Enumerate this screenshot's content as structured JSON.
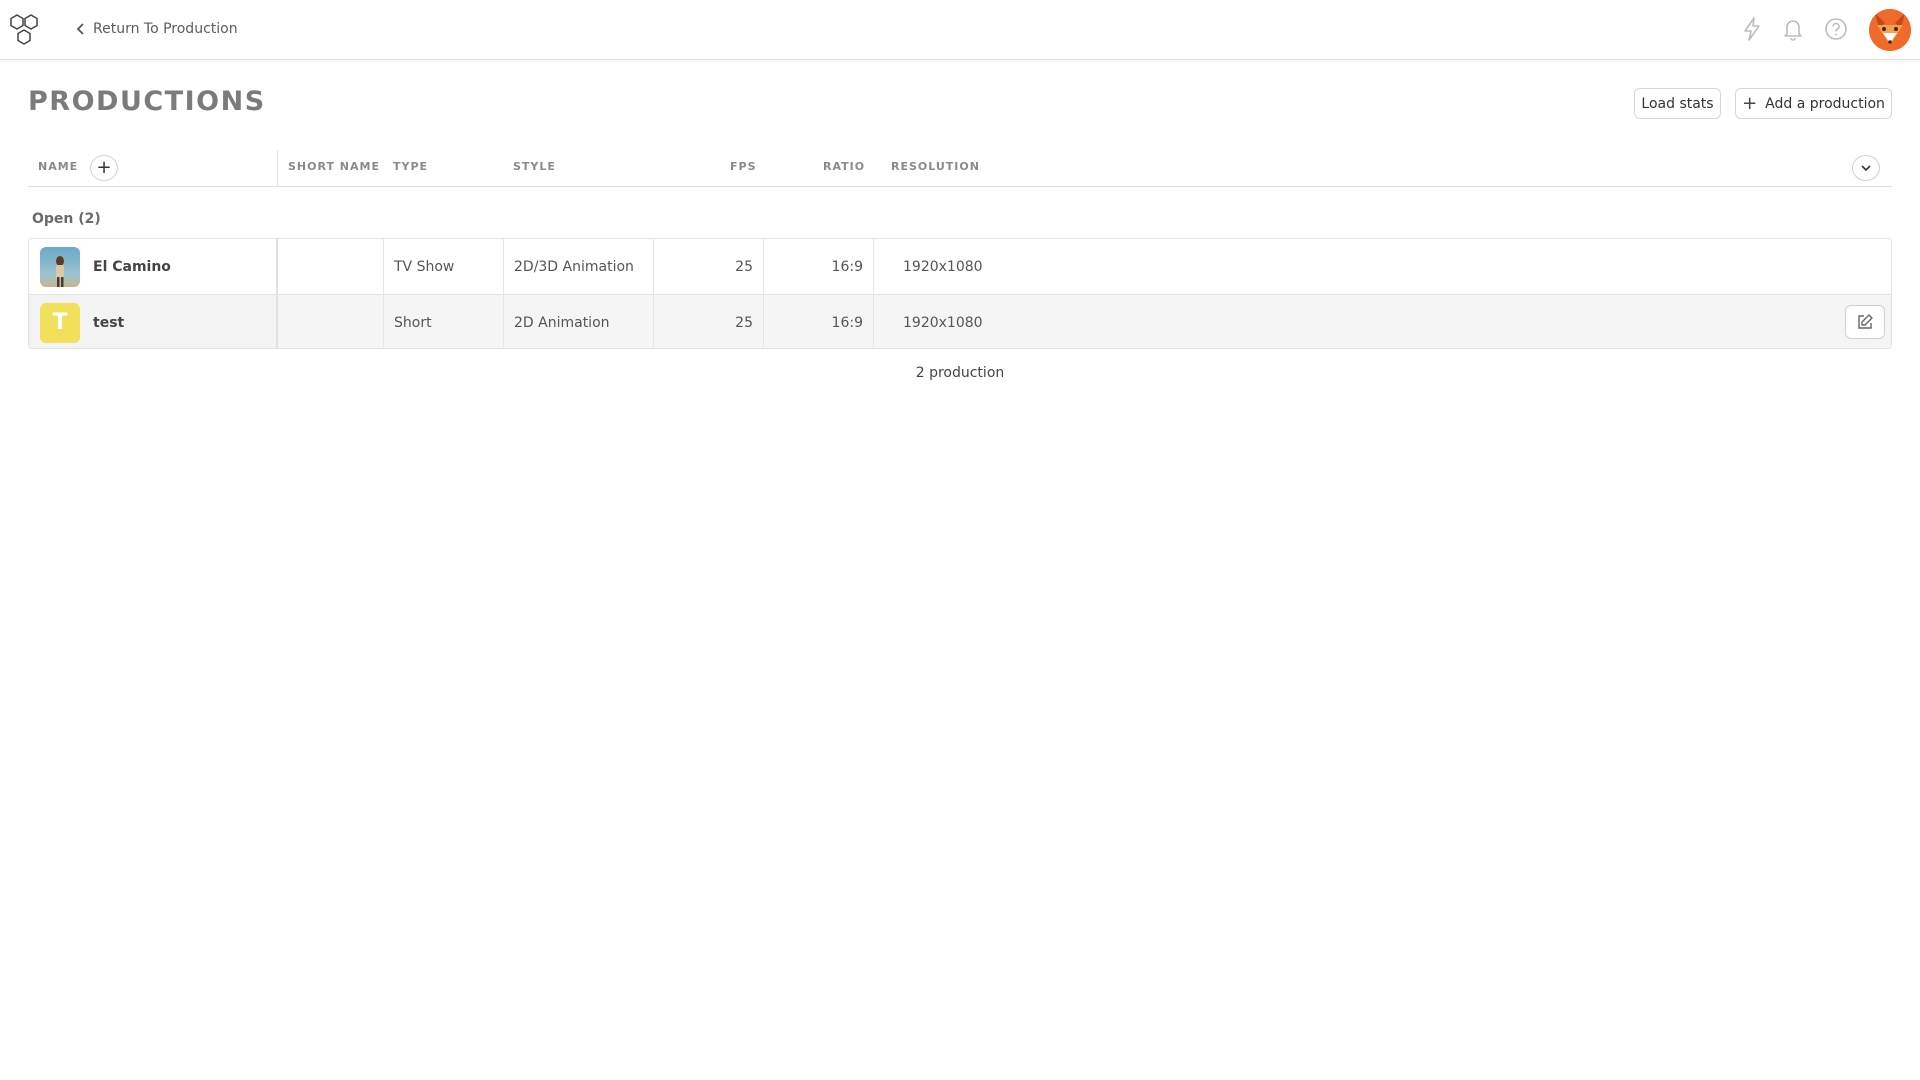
{
  "topbar": {
    "back_label": "Return To Production",
    "icons": [
      "logo-icon",
      "lightning-icon",
      "bell-icon",
      "help-icon",
      "user-avatar"
    ]
  },
  "page": {
    "title": "PRODUCTIONS",
    "load_stats_label": "Load stats",
    "add_production_label": "Add a production"
  },
  "table": {
    "columns": {
      "name": "NAME",
      "short_name": "SHORT NAME",
      "type": "TYPE",
      "style": "STYLE",
      "fps": "FPS",
      "ratio": "RATIO",
      "resolution": "RESOLUTION"
    },
    "group_label": "Open (2)",
    "rows": [
      {
        "name": "El Camino",
        "short_name": "",
        "type": "TV Show",
        "style": "2D/3D Animation",
        "fps": "25",
        "ratio": "16:9",
        "resolution": "1920x1080",
        "thumbnail": "image"
      },
      {
        "name": "test",
        "short_name": "",
        "type": "Short",
        "style": "2D Animation",
        "fps": "25",
        "ratio": "16:9",
        "resolution": "1920x1080",
        "thumbnail_letter": "T",
        "thumbnail_color": "#f2df5a"
      }
    ],
    "footer": "2 production"
  },
  "colors": {
    "accent_letter_avatar": "#f2df5a",
    "user_avatar": "#f06a2c",
    "title": "#7b7b7b"
  }
}
